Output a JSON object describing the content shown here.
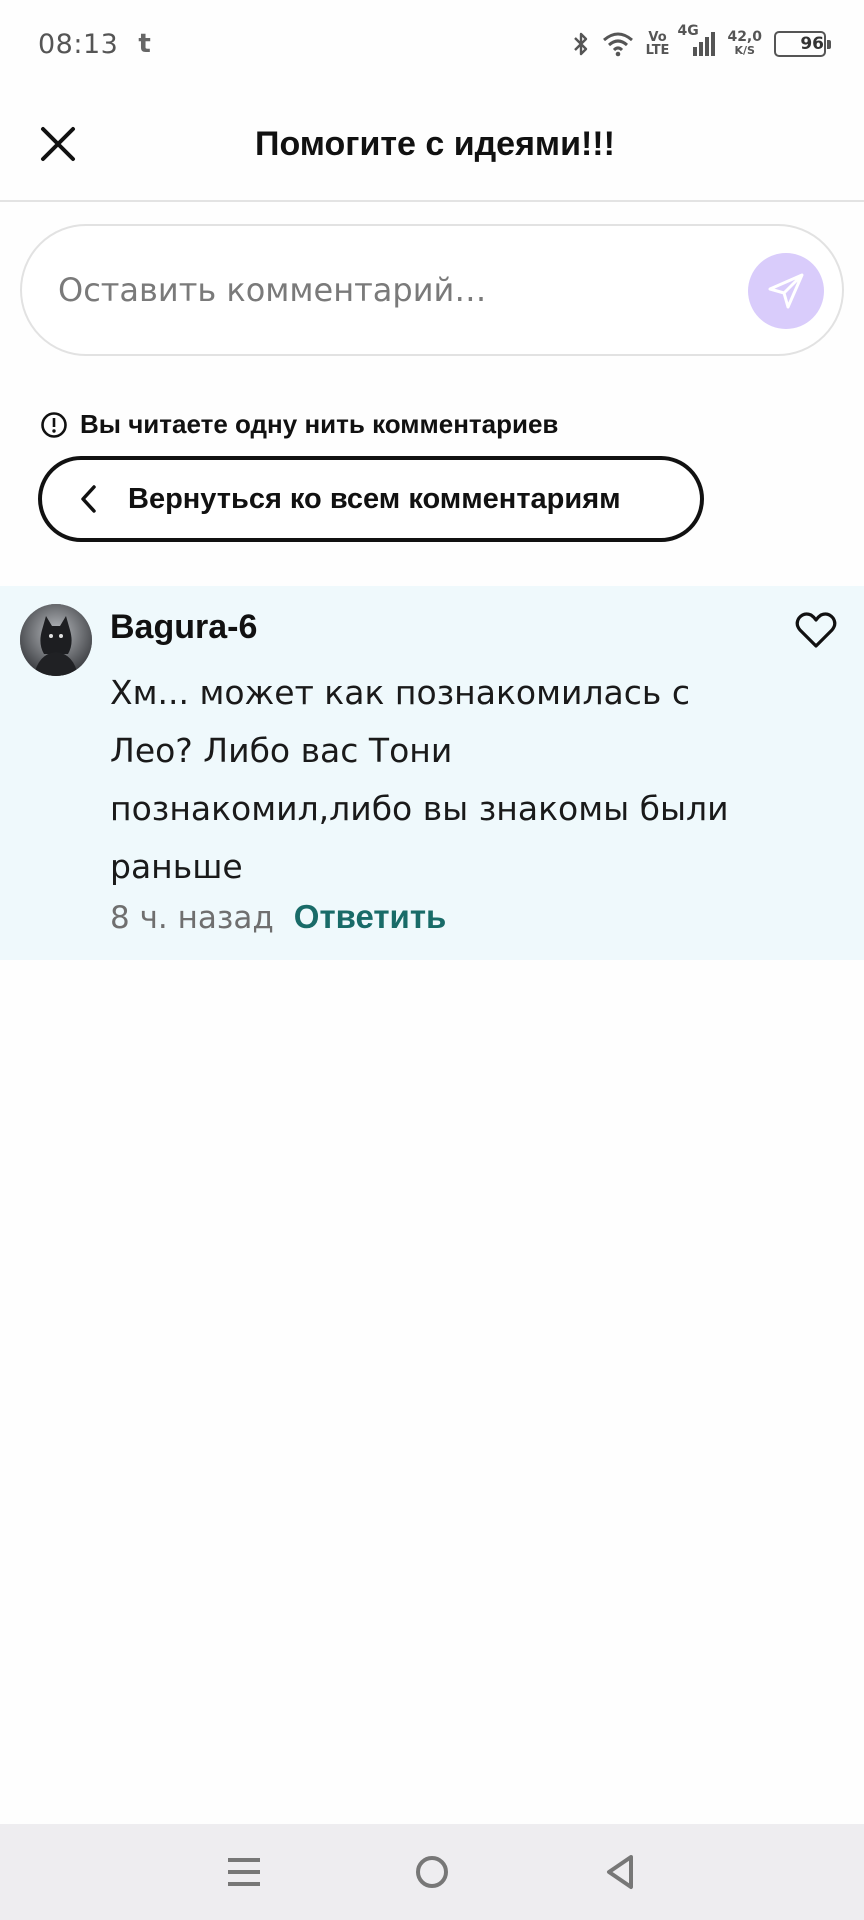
{
  "status_bar": {
    "time": "08:13",
    "app_indicator": "t",
    "network_volte_top": "Vo",
    "network_volte_bottom": "LTE",
    "network_type": "4G",
    "speed_value": "42,0",
    "speed_unit": "K/S",
    "battery": "96",
    "icons": [
      "bluetooth-icon",
      "wifi-icon",
      "signal-icon"
    ]
  },
  "header": {
    "title": "Помогите с идеями!!!",
    "close_icon": "close-icon"
  },
  "comment_input": {
    "placeholder": "Оставить комментарий…",
    "send_icon": "send-icon",
    "send_color": "#d9ccfb"
  },
  "thread": {
    "note": "Вы читаете одну нить комментариев",
    "back_label": "Вернуться ко всем комментариям"
  },
  "comment": {
    "author": "Bagura-6",
    "text": "Хм... может как познакомилась с Лео? Либо вас Тони познакомил,либо вы знакомы были раньше",
    "time": "8 ч. назад",
    "reply_label": "Ответить",
    "reply_color": "#196b68",
    "background": "#eff9fc"
  },
  "nav_bar": {
    "icons": [
      "menu-icon",
      "home-icon",
      "back-icon"
    ]
  }
}
